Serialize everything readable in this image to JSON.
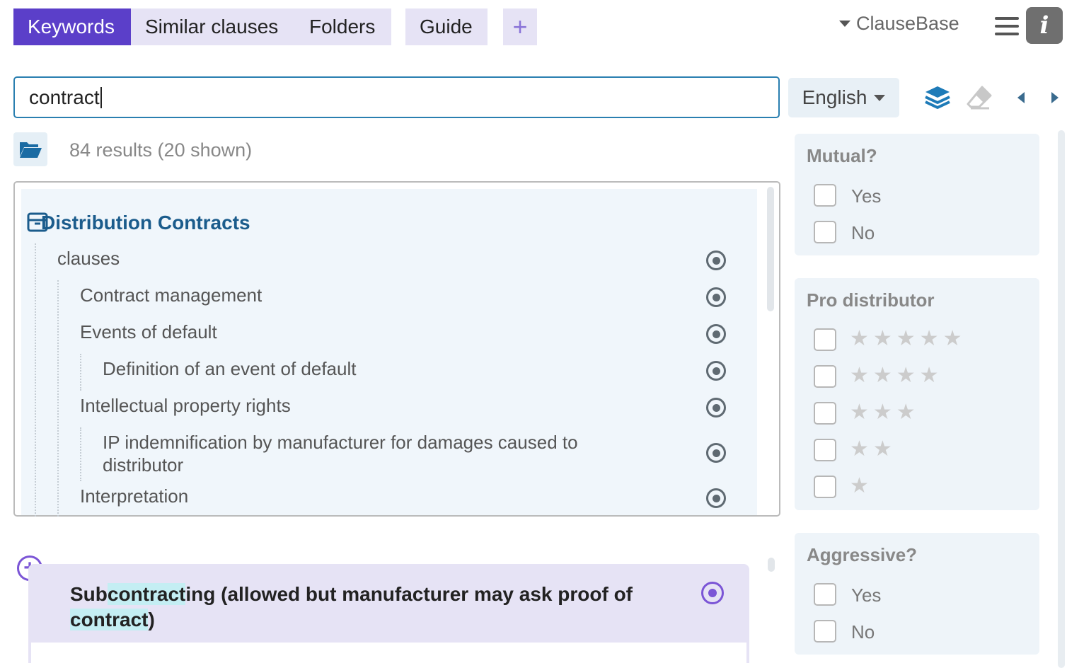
{
  "tabs": [
    {
      "label": "Keywords",
      "active": true
    },
    {
      "label": "Similar clauses",
      "active": false
    },
    {
      "label": "Folders",
      "active": false
    },
    {
      "label": "Guide",
      "active": false
    }
  ],
  "add_tab_symbol": "+",
  "brand": {
    "label": "ClauseBase"
  },
  "info_symbol": "i",
  "search": {
    "value": "contract"
  },
  "language": {
    "selected": "English"
  },
  "results": {
    "count_text": "84 results (20 shown)"
  },
  "tree": {
    "title": "Distribution Contracts",
    "items": [
      {
        "label": "clauses"
      },
      {
        "label": "Contract management"
      },
      {
        "label": "Events of default"
      },
      {
        "label": "Definition of an event of default"
      },
      {
        "label": "Intellectual property rights"
      },
      {
        "label": "IP indemnification by manufacturer for damages caused to distributor"
      },
      {
        "label": "Interpretation"
      }
    ]
  },
  "clause": {
    "title_parts": [
      "Sub",
      "contract",
      "ing (allowed but manufacturer may ask proof of ",
      "contract",
      ")"
    ]
  },
  "filters": {
    "mutual": {
      "title": "Mutual?",
      "options": [
        "Yes",
        "No"
      ]
    },
    "pro_distributor": {
      "title": "Pro distributor",
      "star_levels": [
        5,
        4,
        3,
        2,
        1
      ]
    },
    "aggressive": {
      "title": "Aggressive?",
      "options": [
        "Yes",
        "No"
      ]
    }
  },
  "colors": {
    "accent": "#5b3fc9",
    "tab_bg": "#e6e3f5",
    "link_blue": "#1b5c8c",
    "highlight": "#c4eef3",
    "purple_icon": "#7b55d6"
  },
  "icons": [
    "plus-icon",
    "chevron-down-icon",
    "menu-icon",
    "info-icon",
    "layers-icon",
    "eraser-icon",
    "arrow-left-icon",
    "arrow-right-icon",
    "folder-open-icon",
    "archive-box-icon",
    "target-icon",
    "plus-circle-icon",
    "checkbox-icon",
    "star-icon"
  ]
}
